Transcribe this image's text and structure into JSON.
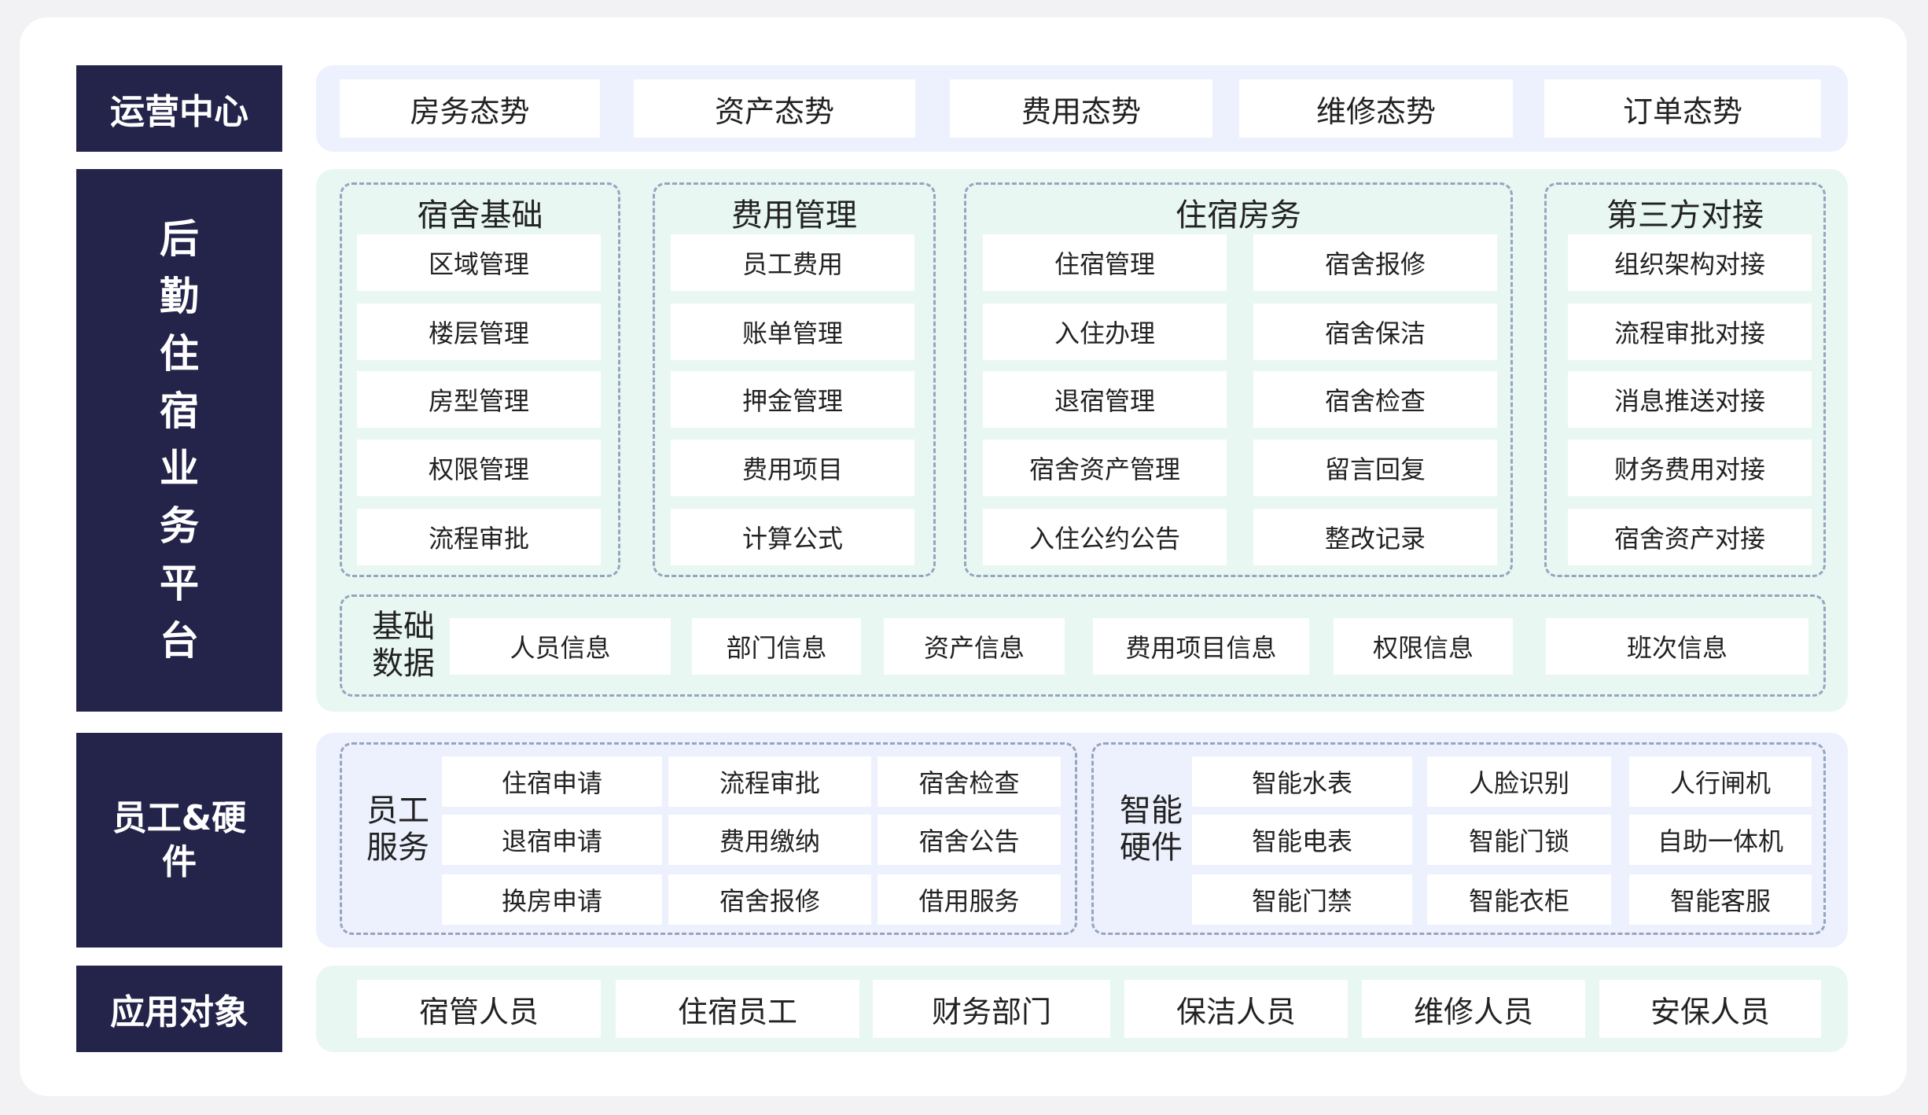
{
  "rows": {
    "operations": {
      "label": "运营中心",
      "items": [
        "房务态势",
        "资产态势",
        "费用态势",
        "维修态势",
        "订单态势"
      ]
    },
    "platform": {
      "label_chars": [
        "后",
        "勤",
        "住",
        "宿",
        "业",
        "务",
        "平",
        "台"
      ],
      "groups": {
        "dorm_basics": {
          "title": "宿舍基础",
          "items": [
            "区域管理",
            "楼层管理",
            "房型管理",
            "权限管理",
            "流程审批"
          ]
        },
        "fee_mgmt": {
          "title": "费用管理",
          "items": [
            "员工费用",
            "账单管理",
            "押金管理",
            "费用项目",
            "计算公式"
          ]
        },
        "housing_affairs": {
          "title": "住宿房务",
          "left": [
            "住宿管理",
            "入住办理",
            "退宿管理",
            "宿舍资产管理",
            "入住公约公告"
          ],
          "right": [
            "宿舍报修",
            "宿舍保洁",
            "宿舍检查",
            "留言回复",
            "整改记录"
          ]
        },
        "third_party": {
          "title": "第三方对接",
          "items": [
            "组织架构对接",
            "流程审批对接",
            "消息推送对接",
            "财务费用对接",
            "宿舍资产对接"
          ]
        }
      },
      "base_data": {
        "label_lines": [
          "基础",
          "数据"
        ],
        "items": [
          "人员信息",
          "部门信息",
          "资产信息",
          "费用项目信息",
          "权限信息",
          "班次信息"
        ]
      }
    },
    "employee_hardware": {
      "label_lines": [
        "员工&硬",
        "件"
      ],
      "services": {
        "label_lines": [
          "员工",
          "服务"
        ],
        "items": [
          "住宿申请",
          "流程审批",
          "宿舍检查",
          "退宿申请",
          "费用缴纳",
          "宿舍公告",
          "换房申请",
          "宿舍报修",
          "借用服务"
        ]
      },
      "hardware": {
        "label_lines": [
          "智能",
          "硬件"
        ],
        "items": [
          "智能水表",
          "人脸识别",
          "人行闸机",
          "智能电表",
          "智能门锁",
          "自助一体机",
          "智能门禁",
          "智能衣柜",
          "智能客服"
        ]
      }
    },
    "audience": {
      "label": "应用对象",
      "items": [
        "宿管人员",
        "住宿员工",
        "财务部门",
        "保洁人员",
        "维修人员",
        "安保人员"
      ]
    }
  },
  "colors": {
    "navy": "#24244a",
    "blue_band": "#edf0fd",
    "green_band": "#e8f7f2",
    "dash": "#94a6bf"
  }
}
